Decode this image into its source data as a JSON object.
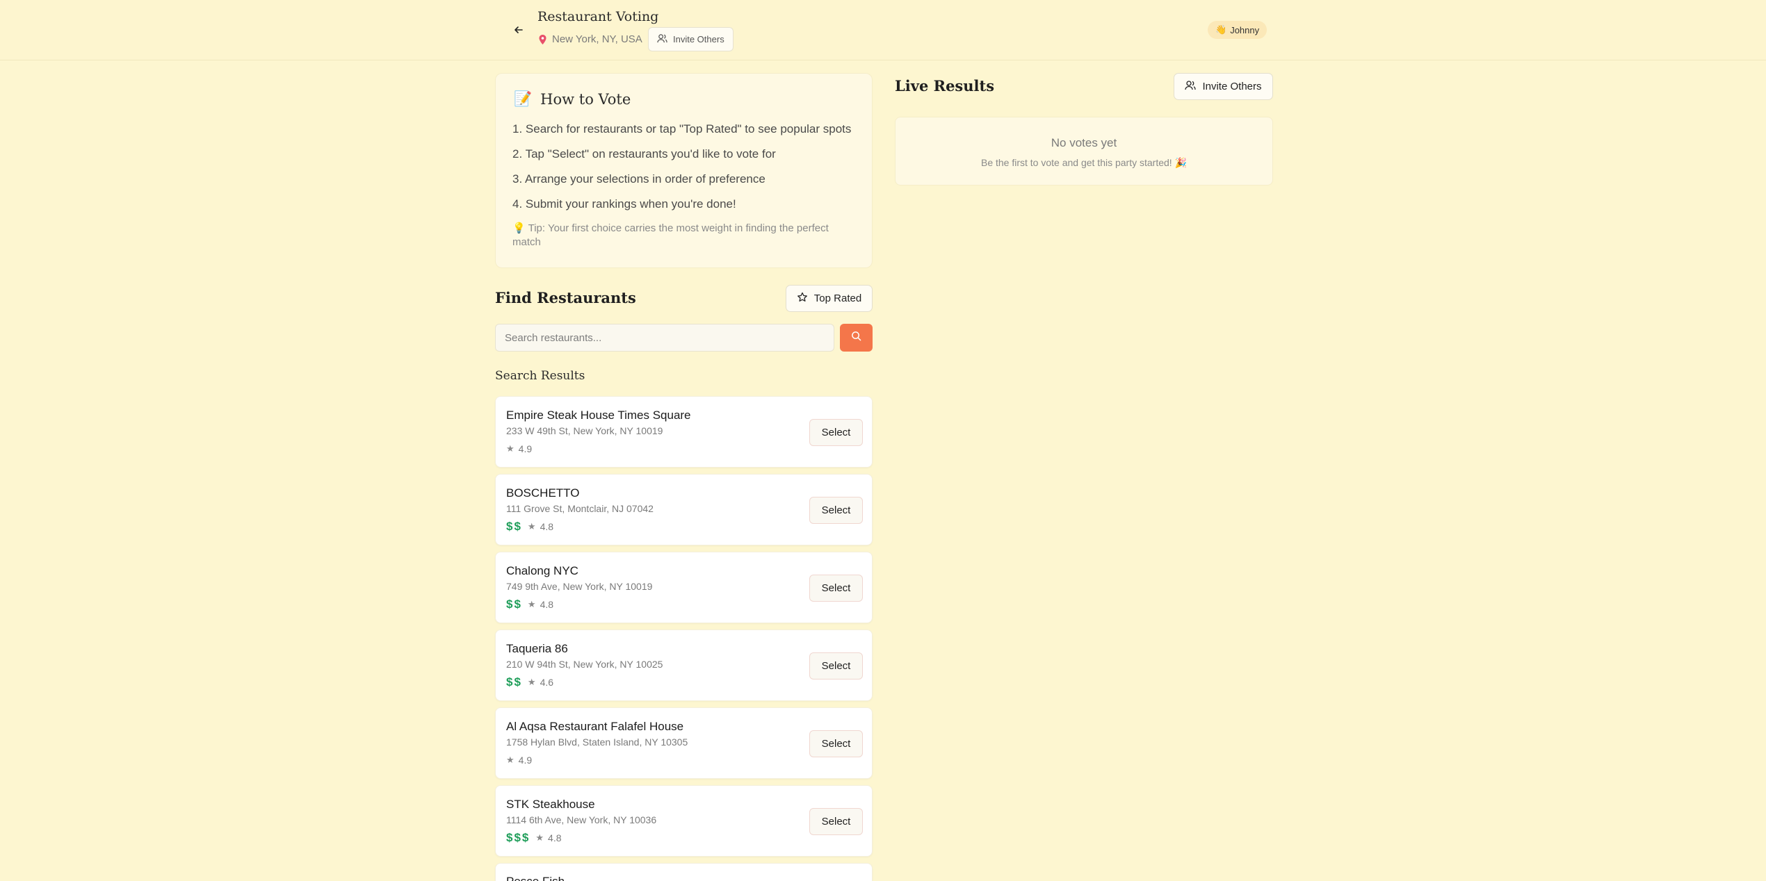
{
  "header": {
    "title": "Restaurant Voting",
    "location": "New York, NY, USA",
    "invite_label": "Invite Others",
    "user_name": "Johnny",
    "user_emoji": "👋"
  },
  "how_to": {
    "emoji": "📝",
    "title": "How to Vote",
    "steps": [
      "1. Search for restaurants or tap \"Top Rated\" to see popular spots",
      "2. Tap \"Select\" on restaurants you'd like to vote for",
      "3. Arrange your selections in order of preference",
      "4. Submit your rankings when you're done!"
    ],
    "tip_emoji": "💡",
    "tip": "Tip: Your first choice carries the most weight in finding the perfect match"
  },
  "find": {
    "title": "Find Restaurants",
    "top_rated_label": "Top Rated",
    "search_placeholder": "Search restaurants...",
    "results_title": "Search Results",
    "select_label": "Select"
  },
  "restaurants": [
    {
      "name": "Empire Steak House Times Square",
      "address": "233 W 49th St, New York, NY 10019",
      "price": "",
      "rating": "4.9"
    },
    {
      "name": "BOSCHETTO",
      "address": "111 Grove St, Montclair, NJ 07042",
      "price": "$$",
      "rating": "4.8"
    },
    {
      "name": "Chalong NYC",
      "address": "749 9th Ave, New York, NY 10019",
      "price": "$$",
      "rating": "4.8"
    },
    {
      "name": "Taqueria 86",
      "address": "210 W 94th St, New York, NY 10025",
      "price": "$$",
      "rating": "4.6"
    },
    {
      "name": "Al Aqsa Restaurant Falafel House",
      "address": "1758 Hylan Blvd, Staten Island, NY 10305",
      "price": "",
      "rating": "4.9"
    },
    {
      "name": "STK Steakhouse",
      "address": "1114 6th Ave, New York, NY 10036",
      "price": "$$$",
      "rating": "4.8"
    },
    {
      "name": "Pesce Fish",
      "address": "",
      "price": "",
      "rating": ""
    }
  ],
  "live": {
    "title": "Live Results",
    "invite_label": "Invite Others",
    "empty_title": "No votes yet",
    "empty_sub": "Be the first to vote and get this party started!",
    "empty_emoji": "🎉"
  },
  "colors": {
    "background": "#fdf6d0",
    "accent": "#f4764a",
    "price_green": "#1f9e5a"
  }
}
